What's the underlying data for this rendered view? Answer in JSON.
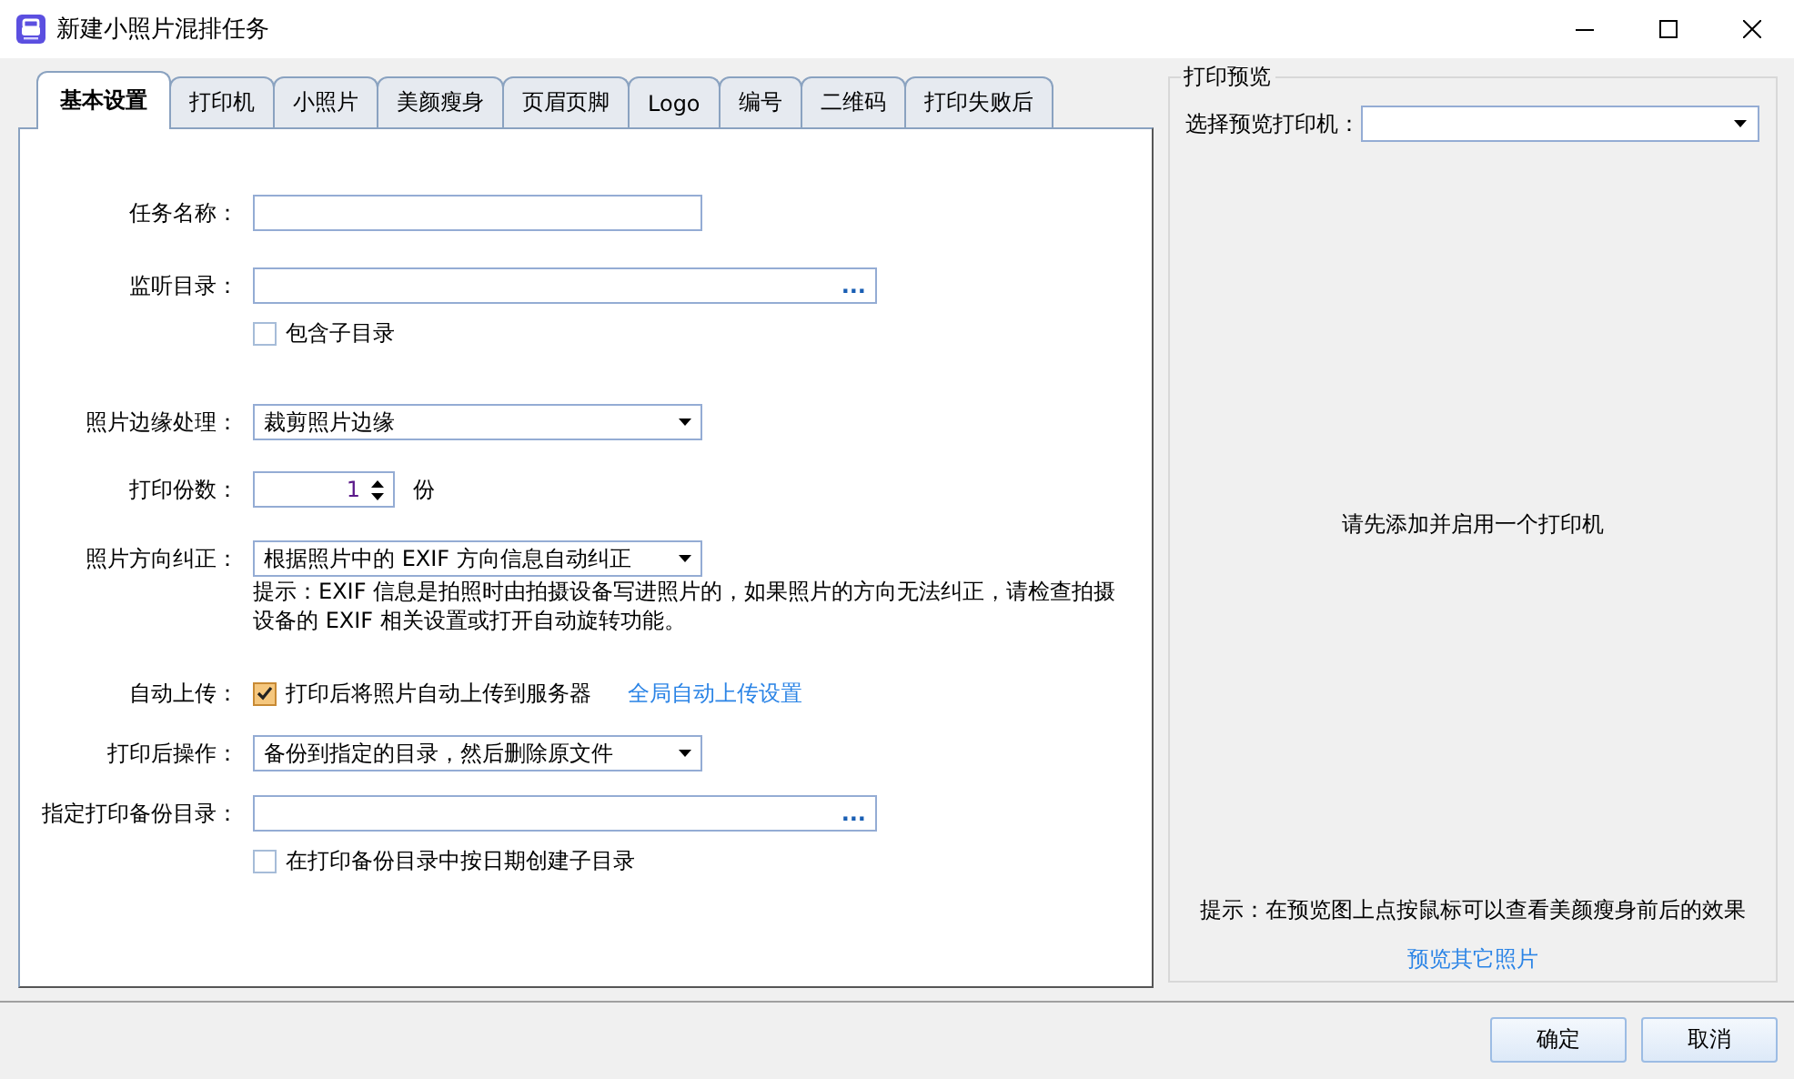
{
  "window": {
    "title": "新建小照片混排任务"
  },
  "tabs": [
    {
      "label": "基本设置",
      "selected": true
    },
    {
      "label": "打印机",
      "selected": false
    },
    {
      "label": "小照片",
      "selected": false
    },
    {
      "label": "美颜瘦身",
      "selected": false
    },
    {
      "label": "页眉页脚",
      "selected": false
    },
    {
      "label": "Logo",
      "selected": false
    },
    {
      "label": "编号",
      "selected": false
    },
    {
      "label": "二维码",
      "selected": false
    },
    {
      "label": "打印失败后",
      "selected": false
    }
  ],
  "form": {
    "rows": [
      {
        "kind": "text",
        "label": "任务名称："
      },
      {
        "kind": "browse",
        "label": "监听目录：",
        "button": "..."
      },
      {
        "kind": "checkbox",
        "text": "包含子目录",
        "checked": false
      },
      {
        "kind": "dropdown",
        "label": "照片边缘处理：",
        "value": "裁剪照片边缘"
      },
      {
        "kind": "spin",
        "label": "打印份数：",
        "value": "1",
        "unit": "份"
      },
      {
        "kind": "dropdown",
        "label": "照片方向纠正：",
        "value": "根据照片中的 EXIF 方向信息自动纠正"
      },
      {
        "kind": "hint",
        "text": "提示：EXIF 信息是拍照时由拍摄设备写进照片的，如果照片的方向无法纠正，请检查拍摄设备的 EXIF 相关设置或打开自动旋转功能。"
      },
      {
        "kind": "checkbox",
        "label": "自动上传：",
        "text": "打印后将照片自动上传到服务器",
        "checked": true,
        "link": "全局自动上传设置"
      },
      {
        "kind": "dropdown",
        "label": "打印后操作：",
        "value": "备份到指定的目录，然后删除原文件"
      },
      {
        "kind": "browse",
        "label": "指定打印备份目录：",
        "button": "..."
      },
      {
        "kind": "checkbox",
        "text": "在打印备份目录中按日期创建子目录",
        "checked": false
      }
    ]
  },
  "preview": {
    "title": "打印预览",
    "printer_label": "选择预览打印机：",
    "message": "请先添加并启用一个打印机",
    "hint": "提示：在预览图上点按鼠标可以查看美颜瘦身前后的效果",
    "link": "预览其它照片"
  },
  "buttons": [
    "确定",
    "取消"
  ]
}
